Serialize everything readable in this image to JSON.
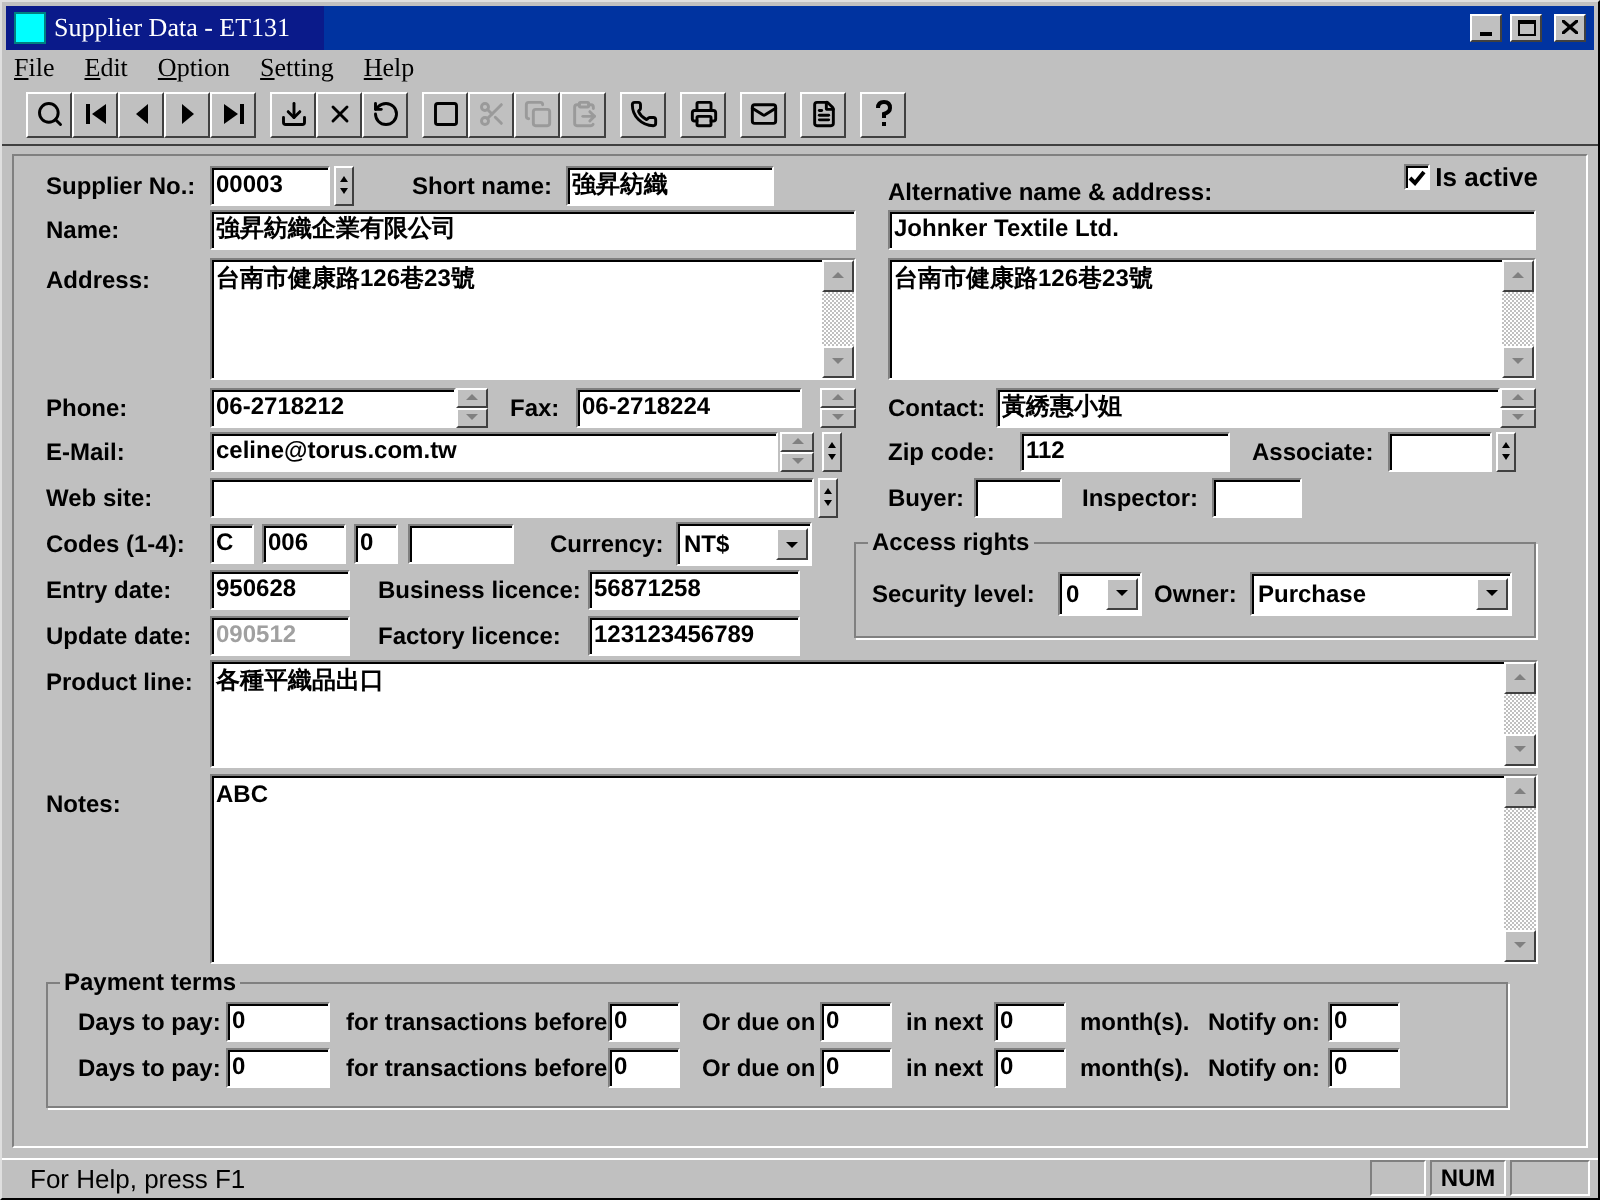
{
  "window": {
    "title": "Supplier Data - ET131"
  },
  "menu": [
    {
      "label": "File"
    },
    {
      "label": "Edit"
    },
    {
      "label": "Option"
    },
    {
      "label": "Setting"
    },
    {
      "label": "Help"
    }
  ],
  "toolbar": [
    {
      "kind": "search",
      "disabled": false
    },
    {
      "kind": "first",
      "disabled": false
    },
    {
      "kind": "prev",
      "disabled": false
    },
    {
      "kind": "next",
      "disabled": false
    },
    {
      "kind": "last",
      "disabled": false,
      "group_end": true
    },
    {
      "kind": "save",
      "disabled": false
    },
    {
      "kind": "delete",
      "disabled": false
    },
    {
      "kind": "undo",
      "disabled": false,
      "group_end": true
    },
    {
      "kind": "new",
      "disabled": false
    },
    {
      "kind": "cut",
      "disabled": true
    },
    {
      "kind": "copy",
      "disabled": true
    },
    {
      "kind": "paste",
      "disabled": true,
      "group_end": true
    },
    {
      "kind": "phone",
      "disabled": false,
      "group_end": true
    },
    {
      "kind": "print",
      "disabled": false,
      "group_end": true
    },
    {
      "kind": "mail",
      "disabled": false,
      "group_end": true
    },
    {
      "kind": "report",
      "disabled": false,
      "group_end": true
    },
    {
      "kind": "help",
      "disabled": false
    }
  ],
  "form": {
    "supplier_no": {
      "label": "Supplier No.:",
      "value": "00003"
    },
    "short_name": {
      "label": "Short name:",
      "value": "強昇紡織"
    },
    "alt_label": "Alternative name & address:",
    "is_active": {
      "label": "Is active",
      "checked": true
    },
    "name": {
      "label": "Name:",
      "value": "強昇紡織企業有限公司"
    },
    "alt_name": {
      "value": "Johnker Textile Ltd."
    },
    "address": {
      "label": "Address:",
      "value": "台南市健康路126巷23號"
    },
    "alt_address": {
      "value": "台南市健康路126巷23號"
    },
    "phone": {
      "label": "Phone:",
      "value": "06-2718212"
    },
    "fax": {
      "label": "Fax:",
      "value": "06-2718224"
    },
    "contact": {
      "label": "Contact:",
      "value": "黃綉惠小姐"
    },
    "email": {
      "label": "E-Mail:",
      "value": "celine@torus.com.tw"
    },
    "zip_code": {
      "label": "Zip code:",
      "value": "112"
    },
    "associate": {
      "label": "Associate:"
    },
    "web_site": {
      "label": "Web site:"
    },
    "buyer": {
      "label": "Buyer:"
    },
    "inspector": {
      "label": "Inspector:"
    },
    "codes": {
      "label": "Codes (1-4):",
      "values": [
        "C",
        "006",
        "0"
      ]
    },
    "currency": {
      "label": "Currency:",
      "value": "NT$"
    },
    "access_rights": {
      "title": "Access rights",
      "security_level": {
        "label": "Security level:",
        "value": "0"
      },
      "owner": {
        "label": "Owner:",
        "value": "Purchase"
      }
    },
    "entry_date": {
      "label": "Entry date:",
      "value": "950628"
    },
    "business_licence": {
      "label": "Business licence:",
      "value": "56871258"
    },
    "update_date": {
      "label": "Update date:",
      "value": "090512",
      "disabled": true
    },
    "factory_licence": {
      "label": "Factory licence:",
      "value": "123123456789"
    },
    "product_line": {
      "label": "Product line:",
      "value": "各種平織品出口"
    },
    "notes": {
      "label": "Notes:",
      "value": "ABC"
    },
    "payment_terms": {
      "title": "Payment terms",
      "rows": [
        {
          "days_label": "Days to pay:",
          "days": "0",
          "before_label": "for transactions before",
          "before": "0",
          "due_label": "Or due on",
          "due": "0",
          "next_label": "in next",
          "next": "0",
          "months_label": "month(s).",
          "notify_label": "Notify on:",
          "notify": "0"
        },
        {
          "days_label": "Days to pay:",
          "days": "0",
          "before_label": "for transactions before",
          "before": "0",
          "due_label": "Or due on",
          "due": "0",
          "next_label": "in next",
          "next": "0",
          "months_label": "month(s).",
          "notify_label": "Notify on:",
          "notify": "0"
        }
      ]
    }
  },
  "status_bar": {
    "text": "For Help, press F1",
    "indicators": [
      "NUM"
    ]
  }
}
